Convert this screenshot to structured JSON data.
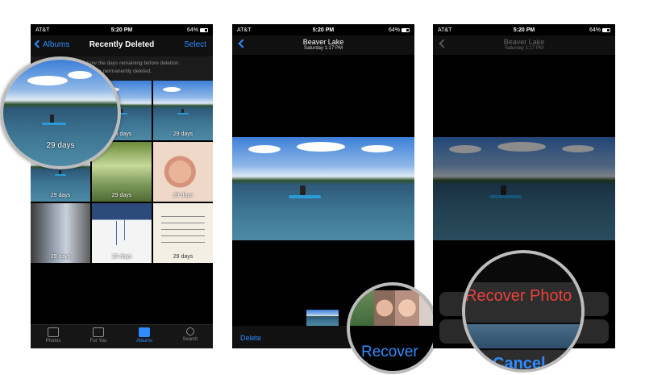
{
  "status_bar": {
    "carrier": "AT&T",
    "time": "5:20 PM",
    "battery": "64%"
  },
  "screen1": {
    "back_label": "Albums",
    "title": "Recently Deleted",
    "select_label": "Select",
    "info_line1": "ter that th    how the days remaining before deletion.",
    "info_line2": "ll be permanently deleted.",
    "days_label": "29 days",
    "tabs": [
      {
        "label": "Photos",
        "icon": "photos-icon"
      },
      {
        "label": "For You",
        "icon": "for-you-icon"
      },
      {
        "label": "Albums",
        "icon": "albums-icon"
      },
      {
        "label": "Search",
        "icon": "search-icon"
      }
    ],
    "active_tab": "Albums",
    "accent_color": "#2f8cff"
  },
  "screen2": {
    "title": "Beaver Lake",
    "subtitle": "Saturday  1:17 PM",
    "delete_label": "Delete",
    "recover_label": "Recover"
  },
  "screen3": {
    "title": "Beaver Lake",
    "subtitle": "Saturday  1:17 PM",
    "recover_photo_label": "Recover Photo",
    "cancel_label": "Cancel",
    "destructive_color": "#e8433a"
  }
}
